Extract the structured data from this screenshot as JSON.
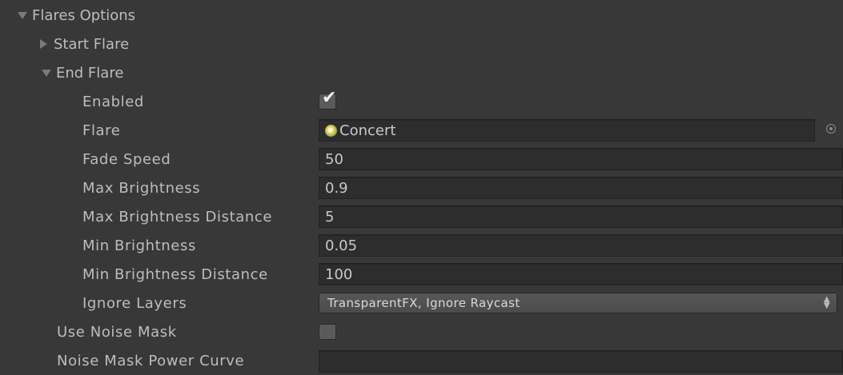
{
  "inspector": {
    "flares_options": "Flares Options",
    "start_flare": "Start Flare",
    "end_flare": "End Flare",
    "enabled": {
      "label": "Enabled",
      "checked": true,
      "mark": "✔"
    },
    "flare": {
      "label": "Flare",
      "value": "Concert"
    },
    "fade_speed": {
      "label": "Fade Speed",
      "value": "50"
    },
    "max_brightness": {
      "label": "Max Brightness",
      "value": "0.9"
    },
    "max_brightness_distance": {
      "label": "Max Brightness Distance",
      "value": "5"
    },
    "min_brightness": {
      "label": "Min Brightness",
      "value": "0.05"
    },
    "min_brightness_distance": {
      "label": "Min Brightness Distance",
      "value": "100"
    },
    "ignore_layers": {
      "label": "Ignore Layers",
      "value": "TransparentFX, Ignore Raycast"
    },
    "use_noise_mask": {
      "label": "Use Noise Mask",
      "checked": false
    },
    "noise_mask_power_curve": {
      "label": "Noise Mask Power Curve"
    }
  },
  "colors": {
    "background": "#383838",
    "field": "#2d2d2d",
    "text": "#bdbdbd"
  },
  "icons": {
    "foldout_open": "triangle-down-icon",
    "foldout_closed": "triangle-right-icon",
    "flare_asset": "flare-asset-icon",
    "object_picker": "object-picker-icon",
    "popup": "updown-arrow-icon"
  }
}
